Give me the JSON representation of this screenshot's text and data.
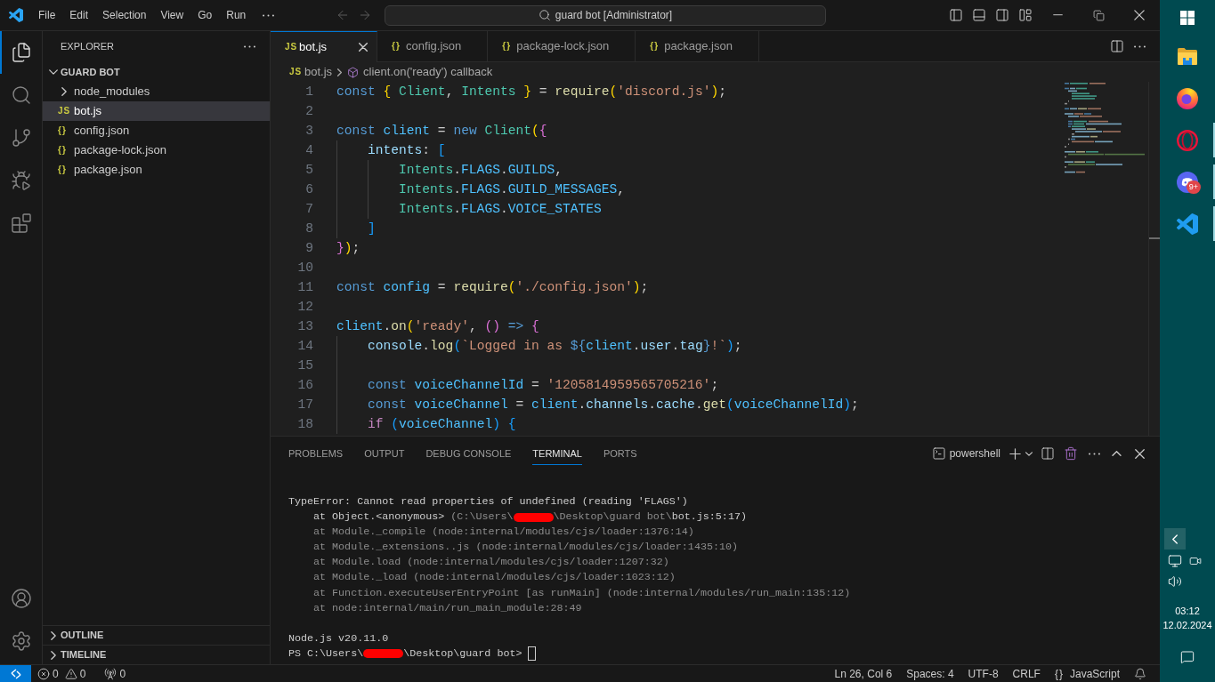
{
  "title_bar": {
    "menu": [
      "File",
      "Edit",
      "Selection",
      "View",
      "Go",
      "Run"
    ],
    "command_center": "guard bot [Administrator]"
  },
  "activity_bar": {
    "items": [
      {
        "kind": "explorer",
        "selected": true
      },
      {
        "kind": "search",
        "selected": false
      },
      {
        "kind": "source-control",
        "selected": false
      },
      {
        "kind": "run-debug",
        "selected": false
      },
      {
        "kind": "extensions",
        "selected": false
      }
    ],
    "bottom": [
      {
        "kind": "accounts"
      },
      {
        "kind": "settings"
      }
    ]
  },
  "sidebar": {
    "title": "EXPLORER",
    "folder": {
      "label": "GUARD BOT",
      "expanded": true,
      "children": [
        {
          "kind": "folder",
          "name": "node_modules",
          "expanded": false,
          "selected": false
        },
        {
          "kind": "file",
          "icon": "JS",
          "name": "bot.js",
          "selected": true
        },
        {
          "kind": "file",
          "icon": "{}",
          "name": "config.json",
          "selected": false
        },
        {
          "kind": "file",
          "icon": "{}",
          "name": "package-lock.json",
          "selected": false
        },
        {
          "kind": "file",
          "icon": "{}",
          "name": "package.json",
          "selected": false
        }
      ]
    },
    "sections": [
      {
        "label": "OUTLINE",
        "expanded": false
      },
      {
        "label": "TIMELINE",
        "expanded": false
      }
    ]
  },
  "editor": {
    "tabs": [
      {
        "icon": "JS",
        "label": "bot.js",
        "selected": true
      },
      {
        "icon": "{}",
        "label": "config.json",
        "selected": false
      },
      {
        "icon": "{}",
        "label": "package-lock.json",
        "selected": false
      },
      {
        "icon": "{}",
        "label": "package.json",
        "selected": false
      }
    ],
    "breadcrumb": {
      "icon": "JS",
      "file": "bot.js",
      "symbol": "client.on('ready') callback"
    },
    "lines": [
      {
        "number": "1",
        "tokens": [
          {
            "kind": "keyword",
            "text": "const "
          },
          {
            "kind": "bracket1",
            "text": "{"
          },
          {
            "kind": "class",
            "text": " Client"
          },
          {
            "kind": "punctuation",
            "text": ", "
          },
          {
            "kind": "class",
            "text": "Intents"
          },
          {
            "kind": "bracket1",
            "text": " }"
          },
          {
            "kind": "punctuation",
            "text": " = "
          },
          {
            "kind": "function",
            "text": "require"
          },
          {
            "kind": "bracket1",
            "text": "("
          },
          {
            "kind": "string",
            "text": "'discord.js'"
          },
          {
            "kind": "bracket1",
            "text": ")"
          },
          {
            "kind": "punctuation",
            "text": ";"
          }
        ]
      },
      {
        "number": "2"
      },
      {
        "number": "3",
        "tokens": [
          {
            "kind": "keyword",
            "text": "const "
          },
          {
            "kind": "constant",
            "text": "client"
          },
          {
            "kind": "punctuation",
            "text": " = "
          },
          {
            "kind": "keyword",
            "text": "new "
          },
          {
            "kind": "class",
            "text": "Client"
          },
          {
            "kind": "bracket1",
            "text": "("
          },
          {
            "kind": "bracket2",
            "text": "{"
          }
        ]
      },
      {
        "number": "4",
        "tokens": [
          {
            "kind": "variable",
            "text": "    intents"
          },
          {
            "kind": "punctuation",
            "text": ": "
          },
          {
            "kind": "bracket3",
            "text": "["
          }
        ]
      },
      {
        "number": "5",
        "tokens": [
          {
            "kind": "class",
            "text": "        Intents"
          },
          {
            "kind": "punctuation",
            "text": "."
          },
          {
            "kind": "constant",
            "text": "FLAGS"
          },
          {
            "kind": "punctuation",
            "text": "."
          },
          {
            "kind": "constant",
            "text": "GUILDS"
          },
          {
            "kind": "punctuation",
            "text": ","
          }
        ]
      },
      {
        "number": "6",
        "tokens": [
          {
            "kind": "class",
            "text": "        Intents"
          },
          {
            "kind": "punctuation",
            "text": "."
          },
          {
            "kind": "constant",
            "text": "FLAGS"
          },
          {
            "kind": "punctuation",
            "text": "."
          },
          {
            "kind": "constant",
            "text": "GUILD_MESSAGES"
          },
          {
            "kind": "punctuation",
            "text": ","
          }
        ]
      },
      {
        "number": "7",
        "tokens": [
          {
            "kind": "class",
            "text": "        Intents"
          },
          {
            "kind": "punctuation",
            "text": "."
          },
          {
            "kind": "constant",
            "text": "FLAGS"
          },
          {
            "kind": "punctuation",
            "text": "."
          },
          {
            "kind": "constant",
            "text": "VOICE_STATES"
          }
        ]
      },
      {
        "number": "8",
        "tokens": [
          {
            "kind": "bracket3",
            "text": "    ]"
          }
        ]
      },
      {
        "number": "9",
        "tokens": [
          {
            "kind": "bracket2",
            "text": "}"
          },
          {
            "kind": "bracket1",
            "text": ")"
          },
          {
            "kind": "punctuation",
            "text": ";"
          }
        ]
      },
      {
        "number": "10"
      },
      {
        "number": "11",
        "tokens": [
          {
            "kind": "keyword",
            "text": "const "
          },
          {
            "kind": "constant",
            "text": "config"
          },
          {
            "kind": "punctuation",
            "text": " = "
          },
          {
            "kind": "function",
            "text": "require"
          },
          {
            "kind": "bracket1",
            "text": "("
          },
          {
            "kind": "string",
            "text": "'./config.json'"
          },
          {
            "kind": "bracket1",
            "text": ")"
          },
          {
            "kind": "punctuation",
            "text": ";"
          }
        ]
      },
      {
        "number": "12"
      },
      {
        "number": "13",
        "tokens": [
          {
            "kind": "constant",
            "text": "client"
          },
          {
            "kind": "punctuation",
            "text": "."
          },
          {
            "kind": "function",
            "text": "on"
          },
          {
            "kind": "bracket1",
            "text": "("
          },
          {
            "kind": "string",
            "text": "'ready'"
          },
          {
            "kind": "punctuation",
            "text": ", "
          },
          {
            "kind": "bracket2",
            "text": "()"
          },
          {
            "kind": "keyword",
            "text": " =>"
          },
          {
            "kind": "bracket2",
            "text": " {"
          }
        ]
      },
      {
        "number": "14",
        "tokens": [
          {
            "kind": "variable",
            "text": "    console"
          },
          {
            "kind": "punctuation",
            "text": "."
          },
          {
            "kind": "function",
            "text": "log"
          },
          {
            "kind": "bracket3",
            "text": "("
          },
          {
            "kind": "string",
            "text": "`Logged in as "
          },
          {
            "kind": "keyword",
            "text": "${"
          },
          {
            "kind": "constant",
            "text": "client"
          },
          {
            "kind": "punctuation",
            "text": "."
          },
          {
            "kind": "variable",
            "text": "user"
          },
          {
            "kind": "punctuation",
            "text": "."
          },
          {
            "kind": "variable",
            "text": "tag"
          },
          {
            "kind": "keyword",
            "text": "}"
          },
          {
            "kind": "string",
            "text": "!`"
          },
          {
            "kind": "bracket3",
            "text": ")"
          },
          {
            "kind": "punctuation",
            "text": ";"
          }
        ]
      },
      {
        "number": "15"
      },
      {
        "number": "16",
        "tokens": [
          {
            "kind": "keyword",
            "text": "    const "
          },
          {
            "kind": "constant",
            "text": "voiceChannelId"
          },
          {
            "kind": "punctuation",
            "text": " = "
          },
          {
            "kind": "string",
            "text": "'1205814959565705216'"
          },
          {
            "kind": "punctuation",
            "text": ";"
          }
        ]
      },
      {
        "number": "17",
        "tokens": [
          {
            "kind": "keyword",
            "text": "    const "
          },
          {
            "kind": "constant",
            "text": "voiceChannel"
          },
          {
            "kind": "punctuation",
            "text": " = "
          },
          {
            "kind": "constant",
            "text": "client"
          },
          {
            "kind": "punctuation",
            "text": "."
          },
          {
            "kind": "variable",
            "text": "channels"
          },
          {
            "kind": "punctuation",
            "text": "."
          },
          {
            "kind": "variable",
            "text": "cache"
          },
          {
            "kind": "punctuation",
            "text": "."
          },
          {
            "kind": "function",
            "text": "get"
          },
          {
            "kind": "bracket3",
            "text": "("
          },
          {
            "kind": "constant",
            "text": "voiceChannelId"
          },
          {
            "kind": "bracket3",
            "text": ")"
          },
          {
            "kind": "punctuation",
            "text": ";"
          }
        ]
      },
      {
        "number": "18",
        "tokens": [
          {
            "kind": "control",
            "text": "    if "
          },
          {
            "kind": "bracket3",
            "text": "("
          },
          {
            "kind": "constant",
            "text": "voiceChannel"
          },
          {
            "kind": "bracket3",
            "text": ")"
          },
          {
            "kind": "bracket3",
            "text": " {"
          }
        ]
      }
    ]
  },
  "panel": {
    "tabs": [
      {
        "label": "PROBLEMS",
        "selected": false
      },
      {
        "label": "OUTPUT",
        "selected": false
      },
      {
        "label": "DEBUG CONSOLE",
        "selected": false
      },
      {
        "label": "TERMINAL",
        "selected": true
      },
      {
        "label": "PORTS",
        "selected": false
      }
    ],
    "terminal_name": "powershell",
    "terminal_blocks": [
      {
        "lines": [
          {
            "segments": [
              {
                "kind": "text",
                "text": "TypeError: Cannot read properties of undefined (reading 'FLAGS')",
                "dim": false
              }
            ]
          },
          {
            "segments": [
              {
                "kind": "text",
                "text": "    at Object.<anonymous> ",
                "dim": false
              },
              {
                "kind": "text",
                "text": "(C:\\Users\\",
                "dim": true
              },
              {
                "kind": "redaction"
              },
              {
                "kind": "text",
                "text": "\\Desktop\\guard bot\\",
                "dim": true
              },
              {
                "kind": "text",
                "text": "bot.js:5:17)",
                "dim": false
              }
            ]
          },
          {
            "segments": [
              {
                "kind": "text",
                "text": "    at Module._compile (node:internal/modules/cjs/loader:1376:14)",
                "dim": true
              }
            ]
          },
          {
            "segments": [
              {
                "kind": "text",
                "text": "    at Module._extensions..js (node:internal/modules/cjs/loader:1435:10)",
                "dim": true
              }
            ]
          },
          {
            "segments": [
              {
                "kind": "text",
                "text": "    at Module.load (node:internal/modules/cjs/loader:1207:32)",
                "dim": true
              }
            ]
          },
          {
            "segments": [
              {
                "kind": "text",
                "text": "    at Module._load (node:internal/modules/cjs/loader:1023:12)",
                "dim": true
              }
            ]
          },
          {
            "segments": [
              {
                "kind": "text",
                "text": "    at Function.executeUserEntryPoint [as runMain] (node:internal/modules/run_main:135:12)",
                "dim": true
              }
            ]
          },
          {
            "segments": [
              {
                "kind": "text",
                "text": "    at node:internal/main/run_main_module:28:49",
                "dim": true
              }
            ]
          }
        ]
      },
      {
        "lines": [
          {
            "segments": [
              {
                "kind": "text",
                "text": "Node.js v20.11.0",
                "dim": false
              }
            ]
          },
          {
            "segments": [
              {
                "kind": "text",
                "text": "PS C:\\Users\\",
                "dim": false
              },
              {
                "kind": "redaction"
              },
              {
                "kind": "text",
                "text": "\\Desktop\\guard bot>",
                "dim": false
              },
              {
                "kind": "cursor"
              }
            ]
          }
        ]
      }
    ]
  },
  "status_bar": {
    "problems": [
      {
        "kind": "errors",
        "count": "0"
      },
      {
        "kind": "warnings",
        "count": "0"
      }
    ],
    "ports": "0",
    "items": [
      "Ln 26, Col 6",
      "Spaces: 4",
      "UTF-8",
      "CRLF"
    ],
    "language": {
      "icon": "{}",
      "label": "JavaScript"
    }
  },
  "taskbar": {
    "apps": [
      {
        "kind": "start",
        "open": false
      },
      {
        "kind": "file-explorer",
        "open": false
      },
      {
        "kind": "firefox",
        "open": false
      },
      {
        "kind": "opera",
        "open": true
      },
      {
        "kind": "discord",
        "open": true,
        "badge": "9+"
      },
      {
        "kind": "vscode",
        "open": true
      }
    ],
    "time": "03:12",
    "date": "12.02.2024"
  }
}
